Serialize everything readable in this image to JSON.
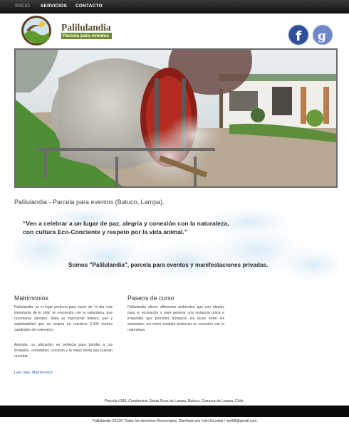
{
  "nav": {
    "items": [
      {
        "label": "INICIO"
      },
      {
        "label": "SERVICIOS"
      },
      {
        "label": "CONTACTO"
      }
    ]
  },
  "header": {
    "brand": "Palilulandia",
    "tagline": "Parcela para eventos",
    "social": [
      "facebook-icon",
      "google-plus-icon"
    ]
  },
  "page_title": "Palilulandia - Parcela para eventos (Batuco, Lampa).",
  "banner": {
    "quote_line1": "“Ven a celebrar a un lugar de paz, alegría y conexión con la naturaleza,",
    "quote_line2": "con cultura Eco-Conciente y respeto por la vida animal.”",
    "somos": "Somos \"Palilulandia\", parcela para eventos y manifestaciones privadas."
  },
  "columns": [
    {
      "title": "Matrimonios",
      "para1": "Palilulandia, es el lugar perfecto para hacer de \"el día más importante de tu vida\" un encuentro con la naturaleza, que recordarás siempre, dada su imponente belleza, paz y espiritualidad que se respira en nuestros 5.000 metros cuadrados de extensión.",
      "para2": "Además, su ubicación es perfecta para brindar a tus invitados, comodidad, cercanía y la mejor fiesta que puedan recordar.",
      "link": "Leer más: Matrimonios"
    },
    {
      "title": "Paseos de curso",
      "para1": "Palilulandia ofrece diferentes ambientes que son ideales para la recreación y para generar una instancia única e irrepetible que permitirá fortalecer los lazos entre los asistentes, así como también potenciar su conexión con la naturaleza."
    }
  ],
  "footer": {
    "address": "Parcela #186, Condominio Santa Rosa de Lampa, Batuco, Comuna de Lampa, Chile.",
    "copyright": "Palilulandia 2013© Todos los derechos Reservados, Diseñado por Iván Escobar / isef08@gmail.com"
  },
  "colors": {
    "nav_bg": "#1a1a1a",
    "footer_bar": "#0a0a0a",
    "link": "#2a5db0",
    "tagline_bg": "#6d8c2f"
  }
}
